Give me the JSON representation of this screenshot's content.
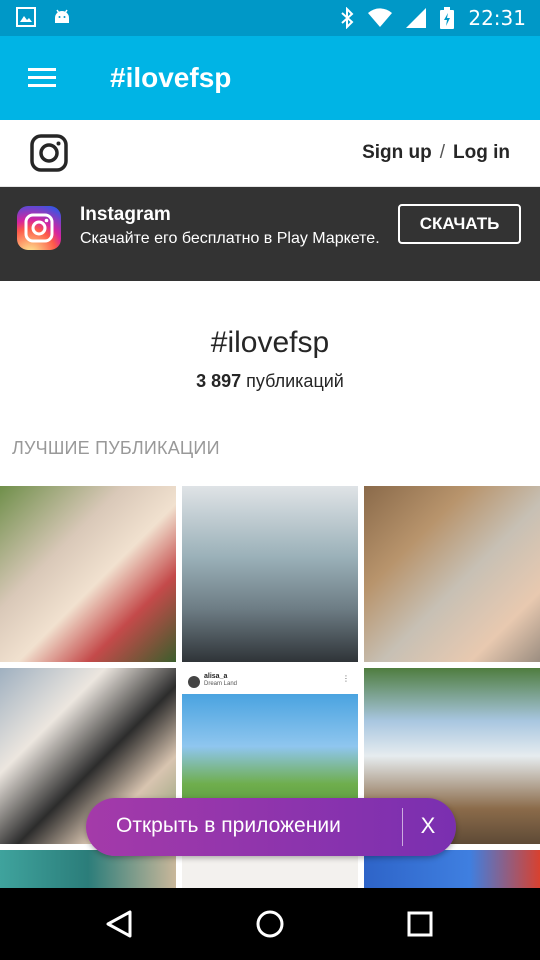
{
  "status_bar": {
    "time": "22:31",
    "icons": [
      "image-icon",
      "android-icon",
      "bluetooth-icon",
      "wifi-icon",
      "signal-icon",
      "battery-icon"
    ]
  },
  "app_bar": {
    "title": "#ilovefsp"
  },
  "ig_header": {
    "sign_up": "Sign up",
    "separator": "/",
    "log_in": "Log in"
  },
  "banner": {
    "title": "Instagram",
    "subtitle": "Скачайте его бесплатно в Play Маркете.",
    "button": "СКАЧАТЬ"
  },
  "hashtag": {
    "title": "#ilovefsp",
    "count": "3 897",
    "count_suffix": " публикаций"
  },
  "section": {
    "label": "ЛУЧШИЕ ПУБЛИКАЦИИ"
  },
  "grid_posts": [
    {
      "username": "alisa_a",
      "location": "Dream Land"
    }
  ],
  "open_app": {
    "label": "Открыть в приложении",
    "close": "X"
  },
  "colors": {
    "status_bar": "#0098c7",
    "app_bar": "#00b4e5",
    "banner": "#333333",
    "pill": "#8f35ad"
  }
}
